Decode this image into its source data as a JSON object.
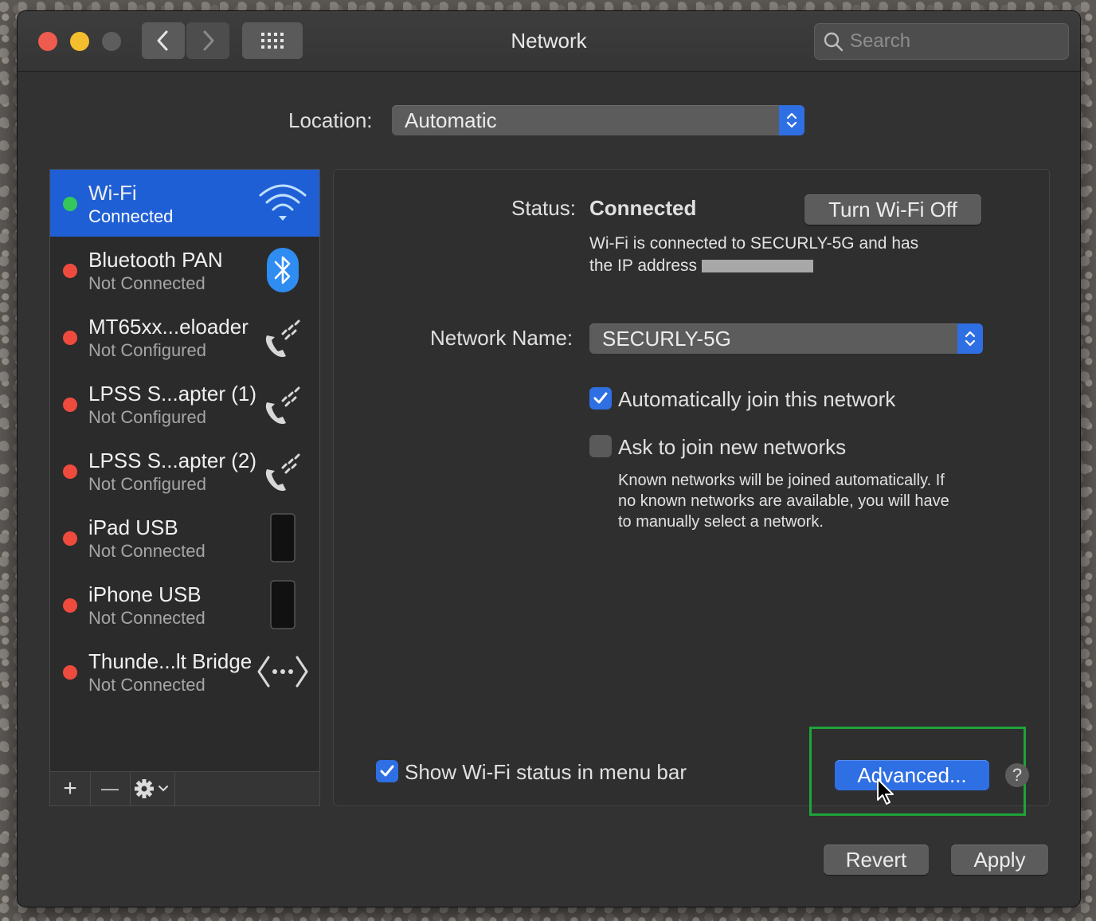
{
  "window": {
    "title": "Network",
    "search_placeholder": "Search"
  },
  "location": {
    "label": "Location:",
    "value": "Automatic"
  },
  "services": [
    {
      "name": "Wi-Fi",
      "status": "Connected",
      "status_color": "#35c759",
      "icon": "wifi-icon",
      "selected": true
    },
    {
      "name": "Bluetooth PAN",
      "status": "Not Connected",
      "status_color": "#ee4b3e",
      "icon": "bluetooth-icon"
    },
    {
      "name": "MT65xx...eloader",
      "status": "Not Configured",
      "status_color": "#ee4b3e",
      "icon": "phone-icon"
    },
    {
      "name": "LPSS S...apter (1)",
      "status": "Not Configured",
      "status_color": "#ee4b3e",
      "icon": "phone-icon"
    },
    {
      "name": "LPSS S...apter (2)",
      "status": "Not Configured",
      "status_color": "#ee4b3e",
      "icon": "phone-icon"
    },
    {
      "name": "iPad USB",
      "status": "Not Connected",
      "status_color": "#ee4b3e",
      "icon": "ipad-icon"
    },
    {
      "name": "iPhone USB",
      "status": "Not Connected",
      "status_color": "#ee4b3e",
      "icon": "iphone-icon"
    },
    {
      "name": "Thunde...lt Bridge",
      "status": "Not Connected",
      "status_color": "#ee4b3e",
      "icon": "thunderbolt-bridge-icon"
    }
  ],
  "toolbar": {
    "add": "+",
    "remove": "—"
  },
  "detail": {
    "status_label": "Status:",
    "status_value": "Connected",
    "turn_off_button": "Turn Wi-Fi Off",
    "status_desc_1": "Wi-Fi is connected to SECURLY-5G and has",
    "status_desc_2": "the IP address",
    "network_name_label": "Network Name:",
    "network_name_value": "SECURLY-5G",
    "auto_join_label": "Automatically join this network",
    "ask_join_label": "Ask to join new networks",
    "ask_join_desc_1": "Known networks will be joined automatically. If",
    "ask_join_desc_2": "no known networks are available, you will have",
    "ask_join_desc_3": "to manually select a network.",
    "show_status_label": "Show Wi-Fi status in menu bar",
    "advanced_button": "Advanced...",
    "help": "?"
  },
  "footer": {
    "revert_button": "Revert",
    "apply_button": "Apply"
  },
  "colors": {
    "accent": "#2f6fe4",
    "highlight_box": "#1fa33a"
  }
}
